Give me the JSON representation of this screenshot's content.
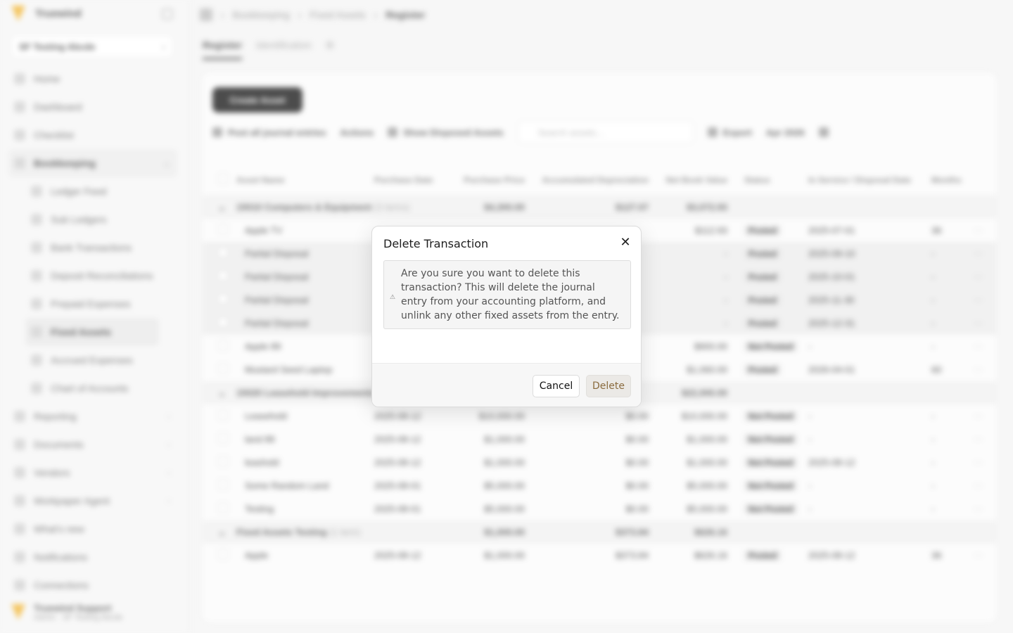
{
  "app": {
    "brand": "Truewind",
    "entity": "SF Testing Abcde",
    "nav": [
      {
        "label": "Home",
        "icon": "home-icon"
      },
      {
        "label": "Dashboard",
        "icon": "dashboard-icon"
      },
      {
        "label": "Checklist",
        "icon": "checklist-icon"
      },
      {
        "label": "Bookkeeping",
        "icon": "book-icon"
      }
    ],
    "bookkeeping_sub": [
      {
        "label": "Ledger Feed"
      },
      {
        "label": "Sub Ledgers"
      },
      {
        "label": "Bank Transactions"
      },
      {
        "label": "Deposit Reconciliations"
      },
      {
        "label": "Prepaid Expenses"
      },
      {
        "label": "Fixed Assets"
      },
      {
        "label": "Accrued Expenses"
      },
      {
        "label": "Chart of Accounts"
      }
    ],
    "nav_bottom": [
      {
        "label": "Reporting"
      },
      {
        "label": "Documents"
      },
      {
        "label": "Vendors"
      },
      {
        "label": "Workpaper Agent"
      }
    ],
    "nav_footer": [
      {
        "label": "What's new"
      },
      {
        "label": "Notifications"
      },
      {
        "label": "Connections"
      }
    ],
    "user": {
      "name": "Truewind Support",
      "sub": "Admin · SF Testing Abcde"
    },
    "breadcrumb": {
      "a": "Bookkeeping",
      "b": "Fixed Assets",
      "c": "Register"
    },
    "tabs": {
      "register": "Register",
      "identification": "Identification"
    },
    "create_btn": "Create Asset",
    "toolbar": {
      "post": "Post all journal entries",
      "actions": "Actions",
      "disposed": "Show Disposed Assets",
      "search_placeholder": "Search assets...",
      "export": "Export",
      "period": "Apr 2026"
    },
    "columns": {
      "name": "Asset Name",
      "pdate": "Purchase Date",
      "price": "Purchase Price",
      "accum": "Accumulated Depreciation",
      "nbv": "Net Book Value",
      "status": "Status",
      "svc": "In Service / Disposal Date",
      "months": "Months"
    },
    "rows": [
      {
        "group": true,
        "name": "15010 Computers & Equipment",
        "count": "(3 items)",
        "price": "$4,300.00",
        "accum": "$127.07",
        "nbv": "$3,072.93"
      },
      {
        "name": "Apple TV",
        "pdate": "",
        "price": "",
        "accum": "",
        "nbv": "$112.93",
        "status": "Posted",
        "svc": "2025-07-01",
        "months": "36"
      },
      {
        "name": "Partial Disposal",
        "nbv": "-",
        "status": "Posted",
        "svc": "2025-09-10",
        "months": "-",
        "hl": true
      },
      {
        "name": "Partial Disposal",
        "nbv": "-",
        "status": "Posted",
        "svc": "2025-10-01",
        "months": "-",
        "hl": true
      },
      {
        "name": "Partial Disposal",
        "nbv": "-",
        "status": "Posted",
        "svc": "2025-11-30",
        "months": "-",
        "hl": true
      },
      {
        "name": "Partial Disposal",
        "nbv": "-",
        "status": "Posted",
        "svc": "2025-12-31",
        "months": "-",
        "hl": true
      },
      {
        "name": "Apple 89",
        "nbv": "$900.00",
        "status": "Not Posted",
        "svc": "-",
        "months": "-"
      },
      {
        "name": "Mustard Seed Laptop",
        "nbv": "$1,060.00",
        "status": "Posted",
        "svc": "2026-04-01",
        "months": "60"
      },
      {
        "group": true,
        "name": "15020 Leasehold Improvements",
        "count": "",
        "price": "",
        "accum": "",
        "nbv": "$22,000.00"
      },
      {
        "name": "Leasehold",
        "pdate": "2025-08-12",
        "price": "$10,000.00",
        "accum": "$0.00",
        "nbv": "$10,000.00",
        "status": "Not Posted",
        "svc": "-",
        "months": "-"
      },
      {
        "name": "land 89",
        "pdate": "2025-08-12",
        "price": "$1,000.00",
        "accum": "$0.00",
        "nbv": "$1,000.00",
        "status": "Not Posted",
        "svc": "-",
        "months": "-"
      },
      {
        "name": "leashold",
        "pdate": "2025-08-12",
        "price": "$1,000.00",
        "accum": "$0.00",
        "nbv": "$1,000.00",
        "status": "Not Posted",
        "svc": "2025-08-12",
        "months": "-"
      },
      {
        "name": "Some Random Land",
        "pdate": "2025-08-01",
        "price": "$5,000.00",
        "accum": "$0.00",
        "nbv": "$5,000.00",
        "status": "Not Posted",
        "svc": "-",
        "months": "-"
      },
      {
        "name": "Testing",
        "pdate": "2025-08-01",
        "price": "$5,000.00",
        "accum": "$0.00",
        "nbv": "$5,000.00",
        "status": "Not Posted",
        "svc": "-",
        "months": "-"
      },
      {
        "group": true,
        "name": "Fixed Assets Testing",
        "count": "(1 item)",
        "price": "$1,000.00",
        "accum": "$373.84",
        "nbv": "$626.16"
      },
      {
        "name": "Apple",
        "pdate": "2025-08-12",
        "price": "$1,000.00",
        "accum": "$373.84",
        "nbv": "$626.16",
        "status": "Posted",
        "svc": "2025-08-12",
        "months": "36"
      }
    ]
  },
  "modal": {
    "title": "Delete Transaction",
    "message": "Are you sure you want to delete this transaction? This will delete the journal entry from your accounting platform, and unlink any other fixed assets from the entry.",
    "cancel_label": "Cancel",
    "delete_label": "Delete",
    "close_glyph": "✕",
    "warn_glyph": "⚠",
    "delete_color": "#8a6b3e"
  }
}
